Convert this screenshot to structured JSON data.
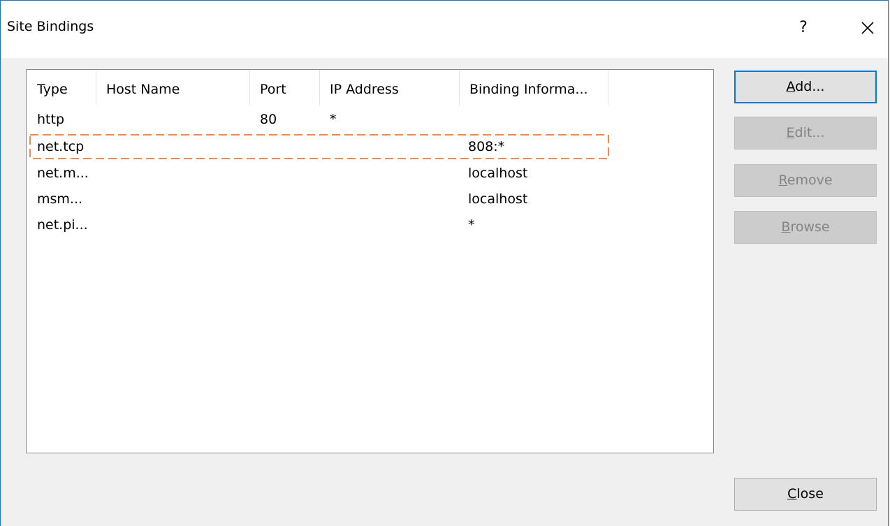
{
  "window": {
    "title": "Site Bindings",
    "help_label": "?"
  },
  "listview": {
    "columns": [
      "Type",
      "Host Name",
      "Port",
      "IP Address",
      "Binding Informa..."
    ],
    "rows": [
      {
        "type": "http",
        "host": "",
        "port": "80",
        "ip": "*",
        "binding": ""
      },
      {
        "type": "net.tcp",
        "host": "",
        "port": "",
        "ip": "",
        "binding": "808:*"
      },
      {
        "type": "net.m...",
        "host": "",
        "port": "",
        "ip": "",
        "binding": "localhost"
      },
      {
        "type": "msm...",
        "host": "",
        "port": "",
        "ip": "",
        "binding": "localhost"
      },
      {
        "type": "net.pi...",
        "host": "",
        "port": "",
        "ip": "",
        "binding": "*"
      }
    ],
    "focused_row": 1,
    "focus_color": "#f08a50"
  },
  "buttons": {
    "add": {
      "accel": "A",
      "rest": "dd...",
      "enabled": true
    },
    "edit": {
      "accel": "E",
      "rest": "dit...",
      "enabled": false
    },
    "remove": {
      "accel": "R",
      "rest": "emove",
      "enabled": false
    },
    "browse": {
      "accel": "B",
      "rest": "rowse",
      "enabled": false
    },
    "close": {
      "accel": "C",
      "rest": "lose",
      "enabled": true
    }
  },
  "colors": {
    "accent": "#0078d7",
    "window_border": "#1f6fb6",
    "disabled_text": "#838383"
  }
}
